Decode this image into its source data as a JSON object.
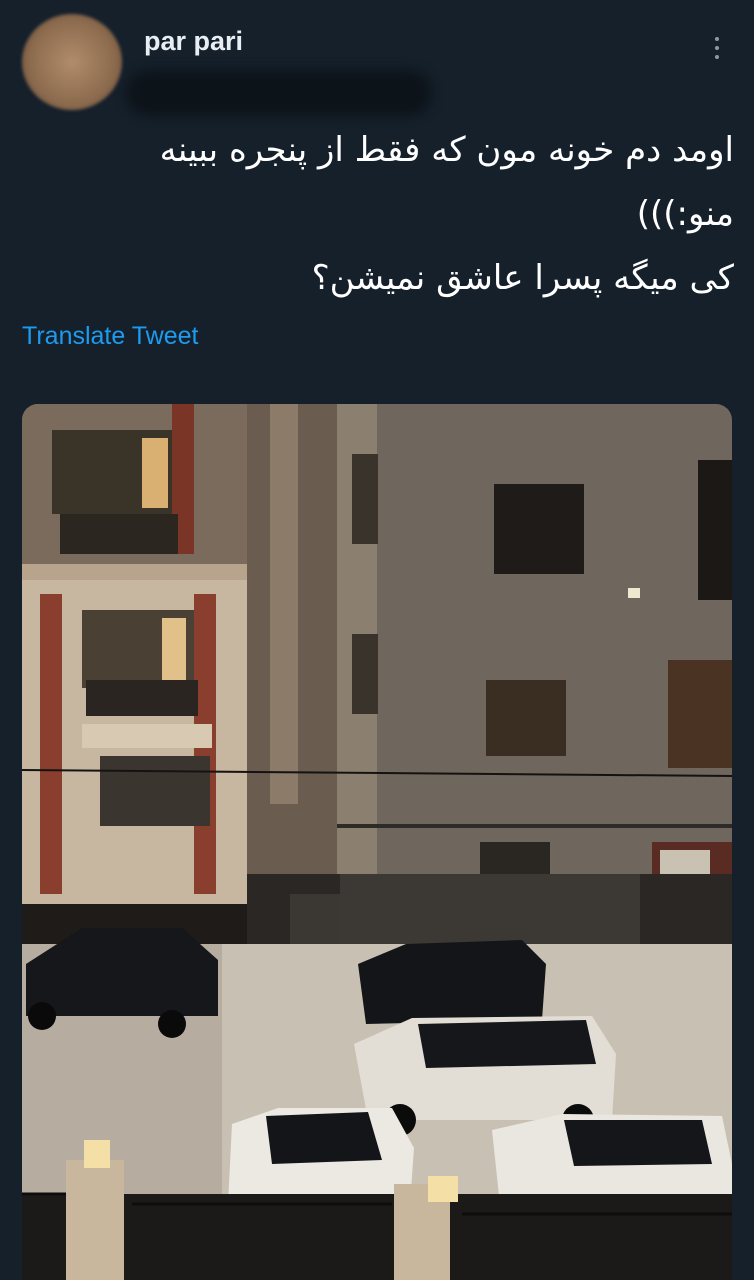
{
  "tweet": {
    "display_name": "par pari",
    "text_lines": [
      "اومد دم خونه مون که فقط از پنجره ببینه",
      "منو:)))",
      "کی میگه پسرا عاشق نمیشن؟"
    ],
    "translate_label": "Translate Tweet",
    "more_icon": "more-vertical-icon",
    "media_subject": "night street with parked cars between apartment buildings"
  },
  "colors": {
    "background": "#15202b",
    "text": "#ffffff",
    "link": "#1d9bf0",
    "muted": "#8b98a5"
  }
}
